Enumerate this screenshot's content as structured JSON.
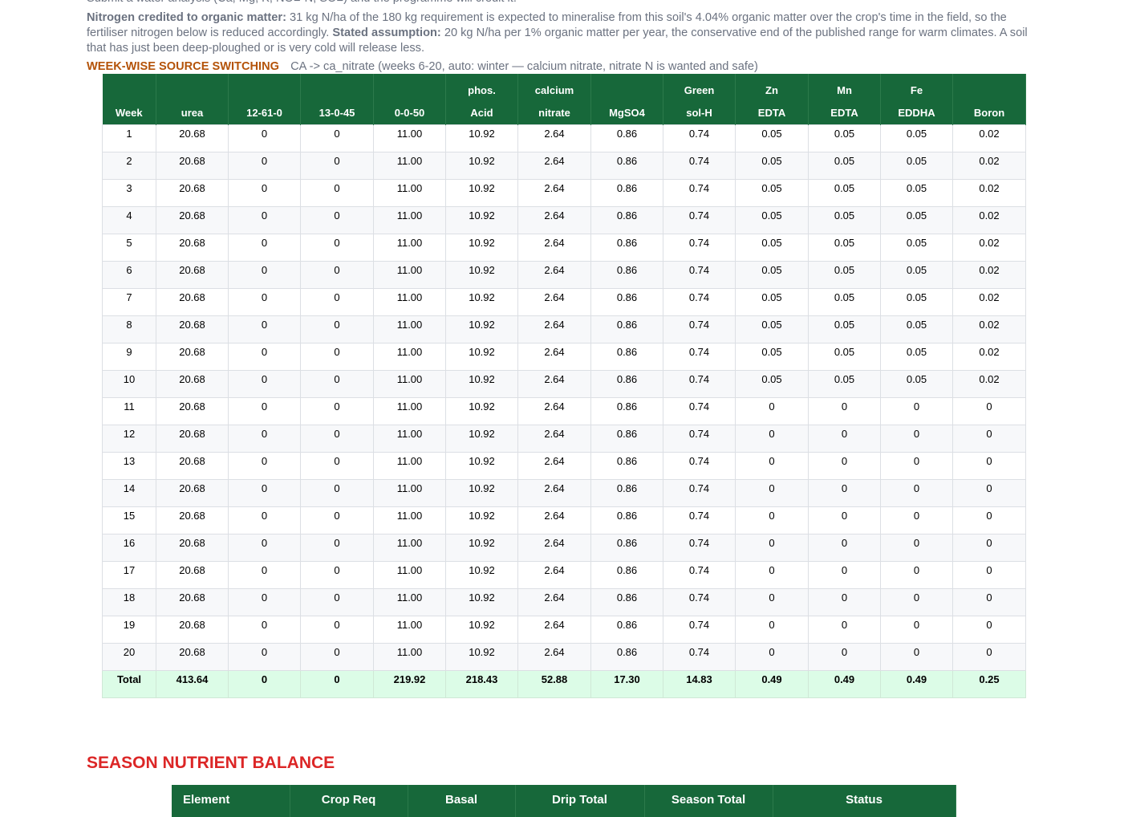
{
  "intro": {
    "water_note": "Submit a water analysis (Ca, Mg, K, NO■-N, SO■) and the programme will credit it.",
    "nitrogen_label": "Nitrogen credited to organic matter:",
    "nitrogen_text": "31 kg N/ha of the 180 kg requirement is expected to mineralise from this soil's 4.04% organic matter over the crop's time in the field, so the fertiliser nitrogen below is reduced accordingly.",
    "assumption_label": "Stated assumption:",
    "assumption_text": "20 kg N/ha per 1% organic matter per year, the conservative end of the published range for warm climates. A soil that has just been deep-ploughed or is very cold will release less."
  },
  "switching": {
    "title": "WEEK-WISE SOURCE SWITCHING",
    "text": "CA -> ca_nitrate (weeks 6-20, auto: winter — calcium nitrate, nitrate N is wanted and safe)"
  },
  "week_table": {
    "headers": [
      [
        "",
        "Week"
      ],
      [
        "",
        "urea"
      ],
      [
        "",
        "12-61-0"
      ],
      [
        "",
        "13-0-45"
      ],
      [
        "",
        "0-0-50"
      ],
      [
        "phos.",
        "Acid"
      ],
      [
        "calcium",
        "nitrate"
      ],
      [
        "",
        "MgSO4"
      ],
      [
        "Green",
        "sol-H"
      ],
      [
        "Zn",
        "EDTA"
      ],
      [
        "Mn",
        "EDTA"
      ],
      [
        "Fe",
        "EDDHA"
      ],
      [
        "",
        "Boron"
      ]
    ],
    "rows": [
      [
        "1",
        "20.68",
        "0",
        "0",
        "11.00",
        "10.92",
        "2.64",
        "0.86",
        "0.74",
        "0.05",
        "0.05",
        "0.05",
        "0.02"
      ],
      [
        "2",
        "20.68",
        "0",
        "0",
        "11.00",
        "10.92",
        "2.64",
        "0.86",
        "0.74",
        "0.05",
        "0.05",
        "0.05",
        "0.02"
      ],
      [
        "3",
        "20.68",
        "0",
        "0",
        "11.00",
        "10.92",
        "2.64",
        "0.86",
        "0.74",
        "0.05",
        "0.05",
        "0.05",
        "0.02"
      ],
      [
        "4",
        "20.68",
        "0",
        "0",
        "11.00",
        "10.92",
        "2.64",
        "0.86",
        "0.74",
        "0.05",
        "0.05",
        "0.05",
        "0.02"
      ],
      [
        "5",
        "20.68",
        "0",
        "0",
        "11.00",
        "10.92",
        "2.64",
        "0.86",
        "0.74",
        "0.05",
        "0.05",
        "0.05",
        "0.02"
      ],
      [
        "6",
        "20.68",
        "0",
        "0",
        "11.00",
        "10.92",
        "2.64",
        "0.86",
        "0.74",
        "0.05",
        "0.05",
        "0.05",
        "0.02"
      ],
      [
        "7",
        "20.68",
        "0",
        "0",
        "11.00",
        "10.92",
        "2.64",
        "0.86",
        "0.74",
        "0.05",
        "0.05",
        "0.05",
        "0.02"
      ],
      [
        "8",
        "20.68",
        "0",
        "0",
        "11.00",
        "10.92",
        "2.64",
        "0.86",
        "0.74",
        "0.05",
        "0.05",
        "0.05",
        "0.02"
      ],
      [
        "9",
        "20.68",
        "0",
        "0",
        "11.00",
        "10.92",
        "2.64",
        "0.86",
        "0.74",
        "0.05",
        "0.05",
        "0.05",
        "0.02"
      ],
      [
        "10",
        "20.68",
        "0",
        "0",
        "11.00",
        "10.92",
        "2.64",
        "0.86",
        "0.74",
        "0.05",
        "0.05",
        "0.05",
        "0.02"
      ],
      [
        "11",
        "20.68",
        "0",
        "0",
        "11.00",
        "10.92",
        "2.64",
        "0.86",
        "0.74",
        "0",
        "0",
        "0",
        "0"
      ],
      [
        "12",
        "20.68",
        "0",
        "0",
        "11.00",
        "10.92",
        "2.64",
        "0.86",
        "0.74",
        "0",
        "0",
        "0",
        "0"
      ],
      [
        "13",
        "20.68",
        "0",
        "0",
        "11.00",
        "10.92",
        "2.64",
        "0.86",
        "0.74",
        "0",
        "0",
        "0",
        "0"
      ],
      [
        "14",
        "20.68",
        "0",
        "0",
        "11.00",
        "10.92",
        "2.64",
        "0.86",
        "0.74",
        "0",
        "0",
        "0",
        "0"
      ],
      [
        "15",
        "20.68",
        "0",
        "0",
        "11.00",
        "10.92",
        "2.64",
        "0.86",
        "0.74",
        "0",
        "0",
        "0",
        "0"
      ],
      [
        "16",
        "20.68",
        "0",
        "0",
        "11.00",
        "10.92",
        "2.64",
        "0.86",
        "0.74",
        "0",
        "0",
        "0",
        "0"
      ],
      [
        "17",
        "20.68",
        "0",
        "0",
        "11.00",
        "10.92",
        "2.64",
        "0.86",
        "0.74",
        "0",
        "0",
        "0",
        "0"
      ],
      [
        "18",
        "20.68",
        "0",
        "0",
        "11.00",
        "10.92",
        "2.64",
        "0.86",
        "0.74",
        "0",
        "0",
        "0",
        "0"
      ],
      [
        "19",
        "20.68",
        "0",
        "0",
        "11.00",
        "10.92",
        "2.64",
        "0.86",
        "0.74",
        "0",
        "0",
        "0",
        "0"
      ],
      [
        "20",
        "20.68",
        "0",
        "0",
        "11.00",
        "10.92",
        "2.64",
        "0.86",
        "0.74",
        "0",
        "0",
        "0",
        "0"
      ]
    ],
    "total": [
      "Total",
      "413.64",
      "0",
      "0",
      "219.92",
      "218.43",
      "52.88",
      "17.30",
      "14.83",
      "0.49",
      "0.49",
      "0.49",
      "0.25"
    ]
  },
  "balance": {
    "title": "SEASON NUTRIENT BALANCE",
    "headers": [
      "Element",
      "Crop Req",
      "Basal",
      "Drip Total",
      "Season Total",
      "Status"
    ]
  },
  "colors": {
    "header_green": "#17683a",
    "total_row": "#dcfce7",
    "section_red": "#dc2626",
    "switch_orange": "#b45309",
    "muted_text": "#6b7280"
  }
}
